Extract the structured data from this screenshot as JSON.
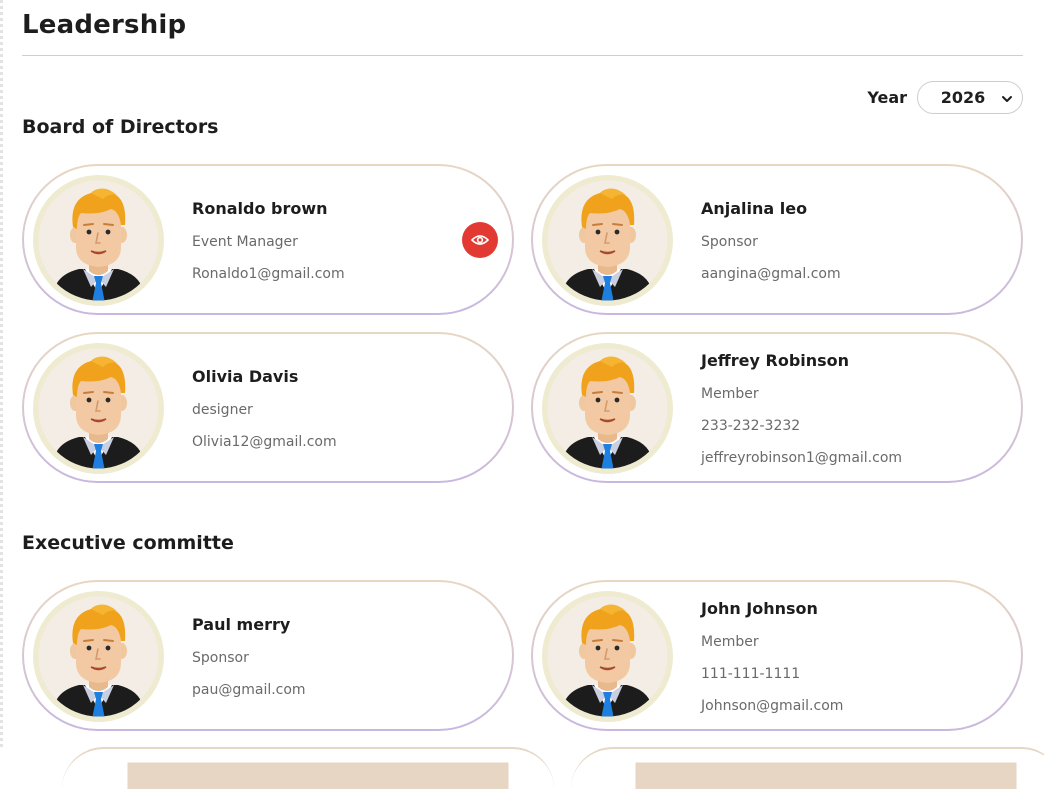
{
  "page": {
    "title": "Leadership"
  },
  "year_filter": {
    "label": "Year",
    "value": "2026"
  },
  "sections": [
    {
      "title": "Board of Directors",
      "members": [
        {
          "name": "Ronaldo brown",
          "role": "Event Manager",
          "details": [
            "Ronaldo1@gmail.com"
          ]
        },
        {
          "name": "Anjalina leo",
          "role": "Sponsor",
          "details": [
            "aangina@gmal.com"
          ]
        },
        {
          "name": "Olivia Davis",
          "role": "designer",
          "details": [
            "Olivia12@gmail.com"
          ]
        },
        {
          "name": "Jeffrey Robinson",
          "role": "Member",
          "details": [
            "233-232-3232",
            "jeffreyrobinson1@gmail.com"
          ]
        }
      ]
    },
    {
      "title": "Executive committe",
      "members": [
        {
          "name": "Paul merry",
          "role": "Sponsor",
          "details": [
            "pau@gmail.com"
          ]
        },
        {
          "name": "John Johnson",
          "role": "Member",
          "details": [
            "111-111-1111",
            "Johnson@gmail.com"
          ]
        }
      ]
    }
  ],
  "icons": {
    "view": "eye-icon",
    "dropdown": "chevron-down-icon"
  },
  "colors": {
    "view_button": "#e23a33",
    "card_border_top": "#e8d7c2",
    "card_border_bottom": "#c8b7e0"
  }
}
